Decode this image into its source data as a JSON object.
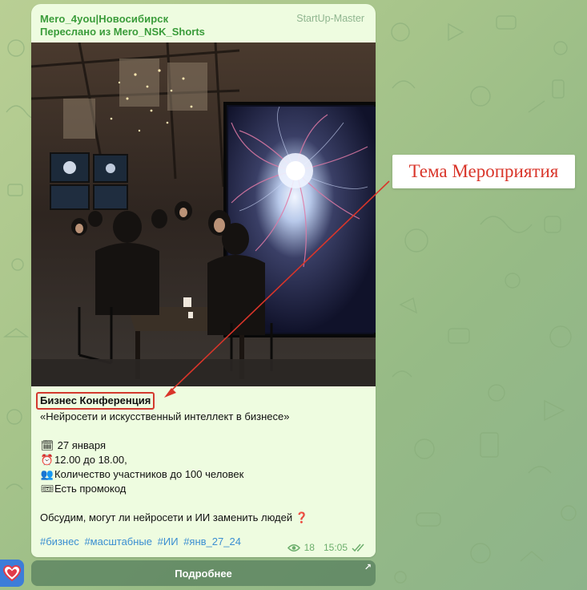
{
  "message": {
    "sender": "Mero_4you|Новосибирск",
    "author_badge": "StartUp-Master",
    "forwarded_from": "Переслано из Mero_NSK_Shorts",
    "title": "Бизнес Конференция",
    "subtitle": "«Нейросети и искусственный интеллект в бизнесе»",
    "date_line": "27 января",
    "time_line": "12.00 до 18.00,",
    "participants_line": "Количество участников до 100 человек",
    "promo_line": "Есть промокод",
    "question_line": "Обсудим, могут ли нейросети и ИИ заменить людей",
    "tags": [
      "#бизнес",
      "#масштабные",
      "#ИИ",
      "#янв_27_24"
    ],
    "views": "18",
    "time": "15:05"
  },
  "button": {
    "label": "Подробнее"
  },
  "annotation": {
    "label": "Тема Мероприятия"
  },
  "icons": {
    "date": "calendar-icon",
    "time": "alarm-clock-icon",
    "participants": "people-icon",
    "promo": "ticket-icon",
    "question": "red-question-mark-icon",
    "views": "eye-icon",
    "status": "double-check-icon",
    "external": "arrow-up-right-icon"
  },
  "colors": {
    "sender": "#3a9c3a",
    "hashtag": "#3b8fd1",
    "highlight": "#d33a2e",
    "bubble": "#eefce0"
  }
}
